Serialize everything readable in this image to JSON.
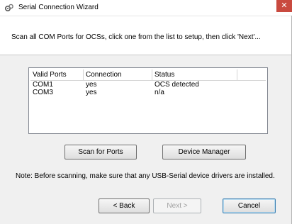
{
  "window": {
    "title": "Serial Connection Wizard",
    "close_glyph": "✕",
    "icon": "wizard-gear-icon"
  },
  "instruction": "Scan all COM Ports for OCSs, click one from the list to setup, then click 'Next'...",
  "ports_list": {
    "columns": [
      "Valid Ports",
      "Connection",
      "Status",
      ""
    ],
    "rows": [
      {
        "port": "COM1",
        "connection": "yes",
        "status": "OCS detected"
      },
      {
        "port": "COM3",
        "connection": "yes",
        "status": "n/a"
      }
    ]
  },
  "buttons": {
    "scan": "Scan for Ports",
    "device_manager": "Device Manager",
    "back": "< Back",
    "next": "Next >",
    "cancel": "Cancel"
  },
  "note": "Note: Before scanning, make sure that any USB-Serial device drivers are installed.",
  "colors": {
    "close_button": "#c94a3f",
    "panel": "#f0f0f0"
  }
}
